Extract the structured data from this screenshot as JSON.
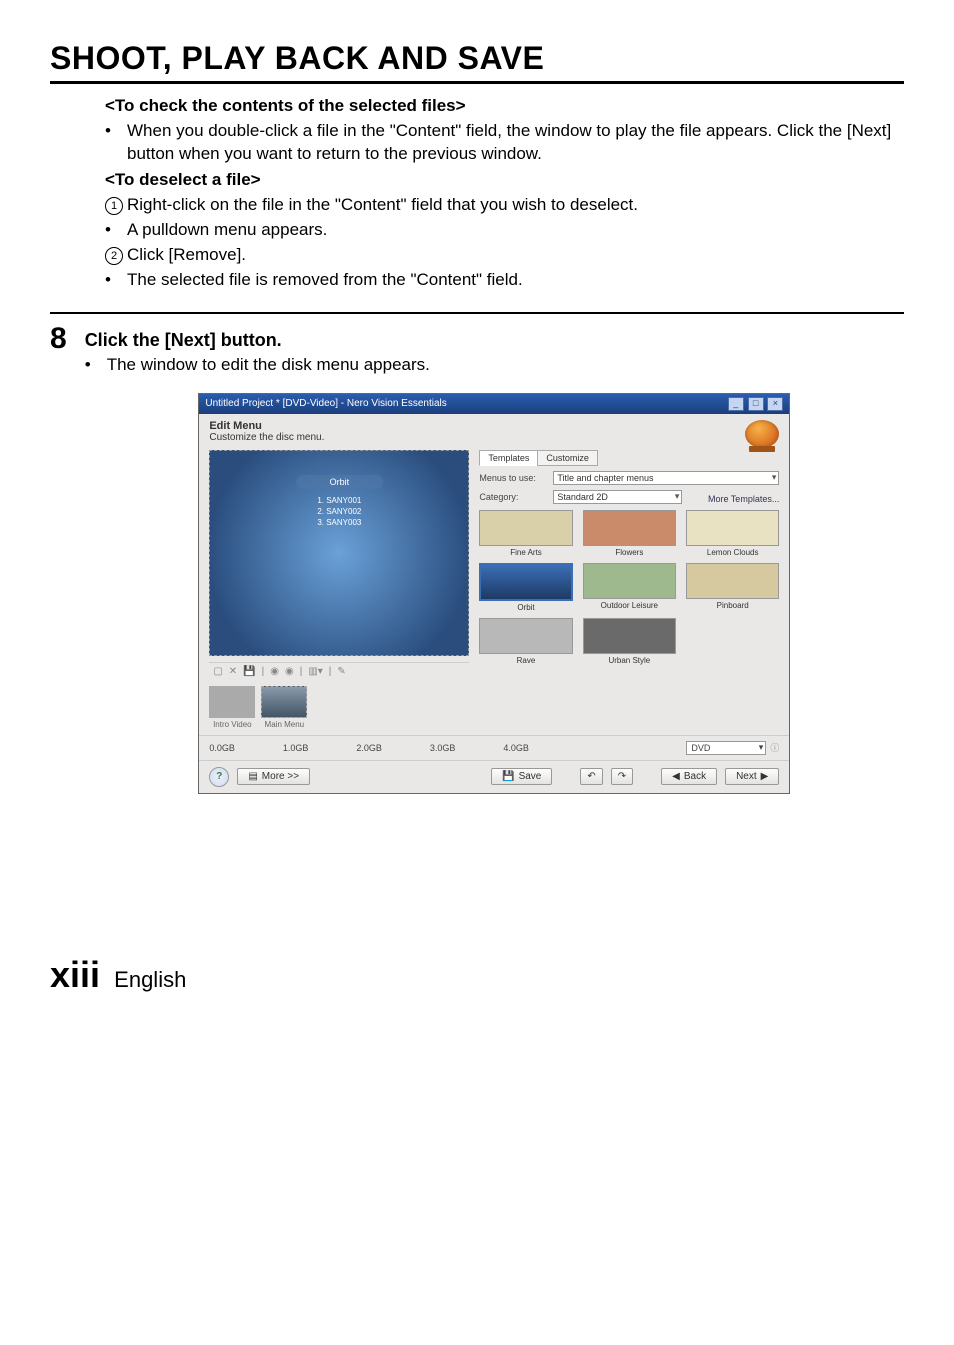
{
  "page": {
    "title": "SHOOT, PLAY BACK AND SAVE",
    "check_heading": "<To check the contents of the selected files>",
    "check_bullet": "When you double-click a file in the \"Content\" field, the window to play the file appears. Click the [Next] button when you want to return to the previous window.",
    "deselect_heading": "<To deselect a file>",
    "deselect_step1": "Right-click on the file in the \"Content\" field that you wish to deselect.",
    "deselect_note1": "A pulldown menu appears.",
    "deselect_step2": "Click [Remove].",
    "deselect_note2": "The selected file is removed from the \"Content\" field.",
    "step8_num": "8",
    "step8_instruction": "Click the [Next] button.",
    "step8_note": "The window to edit the disk menu appears.",
    "footer_roman": "xiii",
    "footer_lang": "English"
  },
  "screenshot": {
    "titlebar": "Untitled Project * [DVD-Video] - Nero Vision Essentials",
    "edit_menu_label": "Edit Menu",
    "edit_menu_sub": "Customize the disc menu.",
    "preview_title": "Orbit",
    "preview_items": [
      "1. SANY001",
      "2. SANY002",
      "3. SANY003"
    ],
    "thumb_intro": "Intro Video",
    "thumb_main": "Main Menu",
    "nero_brand": "nero",
    "tabs": {
      "templates": "Templates",
      "customize": "Customize"
    },
    "menus_to_use_label": "Menus to use:",
    "menus_to_use_value": "Title and chapter menus",
    "category_label": "Category:",
    "category_value": "Standard 2D",
    "more_templates": "More Templates...",
    "templates": [
      "Fine Arts",
      "Flowers",
      "Lemon Clouds",
      "Orbit",
      "Outdoor Leisure",
      "Pinboard",
      "Rave",
      "Urban Style"
    ],
    "scale": [
      "0.0GB",
      "1.0GB",
      "2.0GB",
      "3.0GB",
      "4.0GB"
    ],
    "disc_type": "DVD",
    "buttons": {
      "more": "More >>",
      "save": "Save",
      "back": "Back",
      "next": "Next"
    }
  }
}
